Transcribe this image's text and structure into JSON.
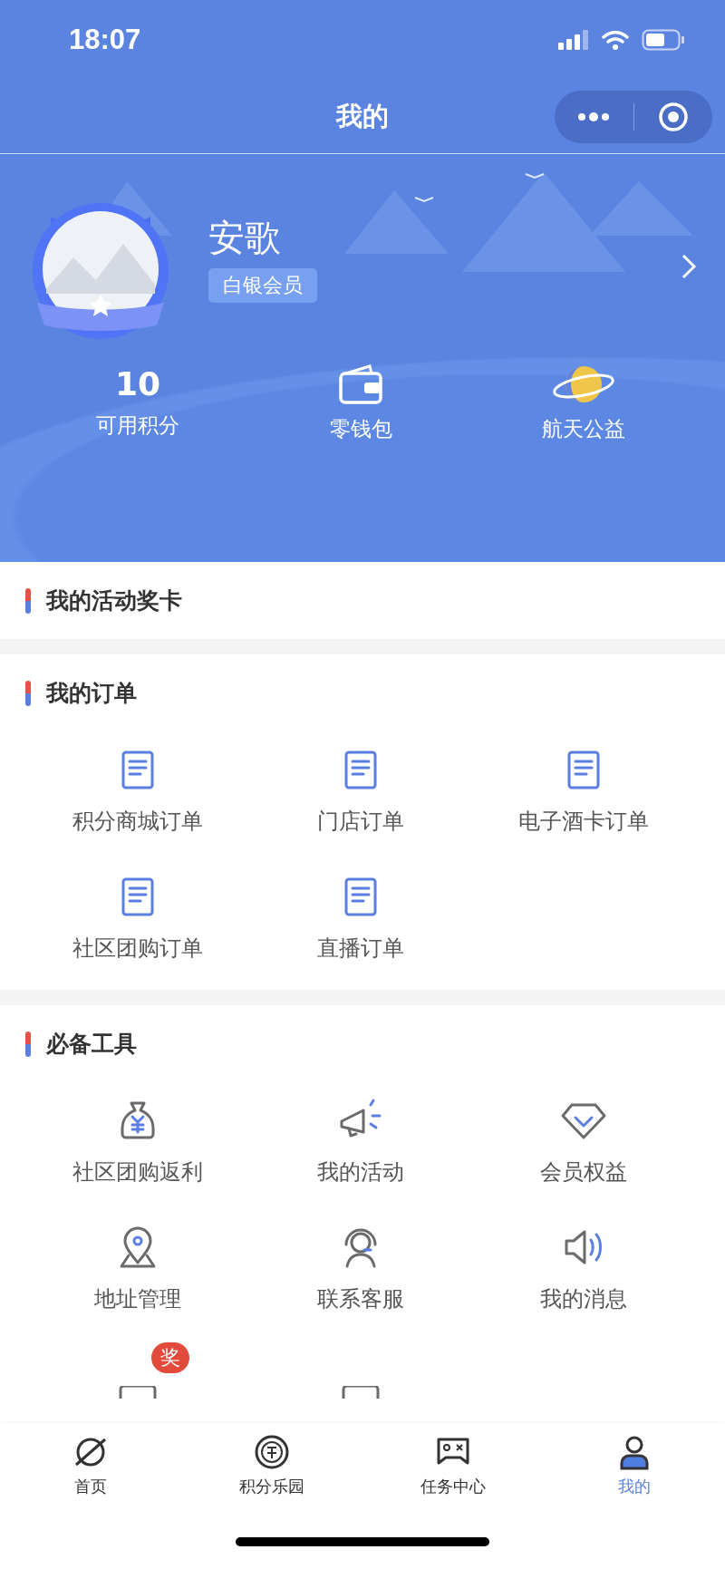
{
  "status_bar": {
    "time": "18:07"
  },
  "nav": {
    "title": "我的"
  },
  "profile": {
    "name": "安歌",
    "tier": "白银会员"
  },
  "stats": [
    {
      "kind": "number",
      "value": "10",
      "label": "可用积分"
    },
    {
      "kind": "wallet",
      "label": "零钱包"
    },
    {
      "kind": "planet",
      "label": "航天公益"
    }
  ],
  "sections": [
    {
      "title": "我的活动奖卡"
    },
    {
      "title": "我的订单",
      "items": [
        {
          "kind": "order",
          "label": "积分商城订单"
        },
        {
          "kind": "order",
          "label": "门店订单"
        },
        {
          "kind": "order",
          "label": "电子酒卡订单"
        },
        {
          "kind": "order",
          "label": "社区团购订单"
        },
        {
          "kind": "order",
          "label": "直播订单"
        }
      ]
    },
    {
      "title": "必备工具",
      "items": [
        {
          "kind": "moneybag",
          "label": "社区团购返利"
        },
        {
          "kind": "megaphone",
          "label": "我的活动"
        },
        {
          "kind": "diamond",
          "label": "会员权益"
        },
        {
          "kind": "location",
          "label": "地址管理"
        },
        {
          "kind": "support",
          "label": "联系客服"
        },
        {
          "kind": "speaker",
          "label": "我的消息"
        },
        {
          "kind": "peek",
          "badge": "奖"
        },
        {
          "kind": "peek"
        }
      ]
    }
  ],
  "tab_bar": [
    {
      "kind": "planet",
      "label": "首页",
      "selected": false
    },
    {
      "kind": "points",
      "label": "积分乐园",
      "selected": false
    },
    {
      "kind": "game",
      "label": "任务中心",
      "selected": false
    },
    {
      "kind": "person",
      "label": "我的",
      "selected": true
    }
  ]
}
